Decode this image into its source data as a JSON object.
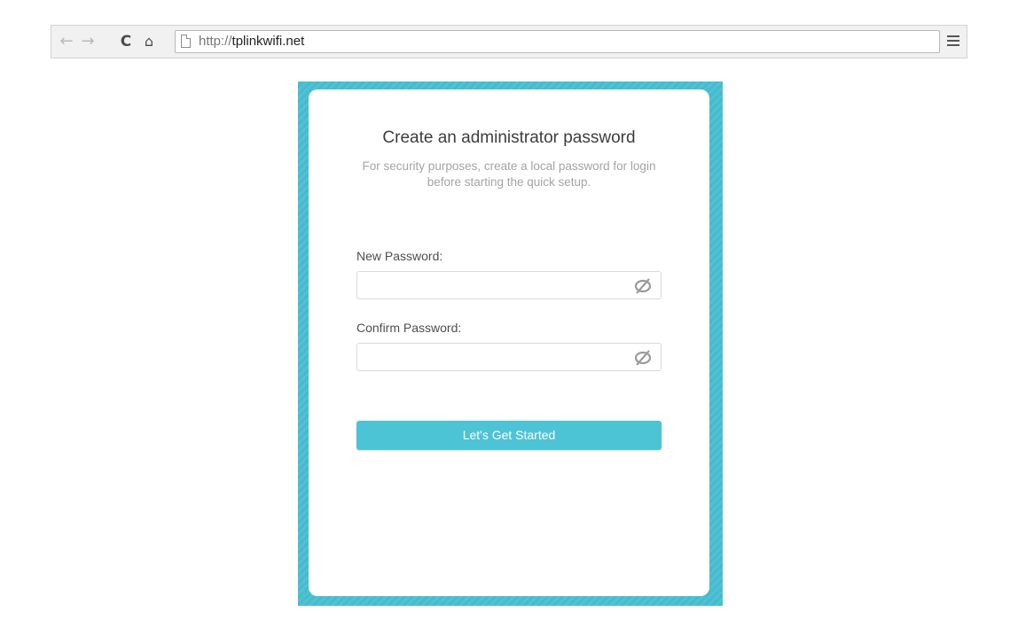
{
  "browser": {
    "back_icon": "←",
    "forward_icon": "→",
    "reload_icon": "C",
    "home_icon": "⌂",
    "url_scheme": "http://",
    "url_host": "tplinkwifi.net"
  },
  "card": {
    "title": "Create an administrator password",
    "subtitle": "For security purposes, create a local password for login before starting the quick setup.",
    "new_password_label": "New Password:",
    "new_password_value": "",
    "confirm_password_label": "Confirm Password:",
    "confirm_password_value": "",
    "submit_label": "Let's Get Started"
  },
  "colors": {
    "frame": "#47bfd1",
    "button": "#4dc3d6",
    "title_text": "#3d3d3d",
    "subtitle_text": "#a4a4a4"
  },
  "icons": {
    "eye_toggle": "eye-slash-icon",
    "menu": "hamburger-menu-icon",
    "page": "page-icon"
  }
}
